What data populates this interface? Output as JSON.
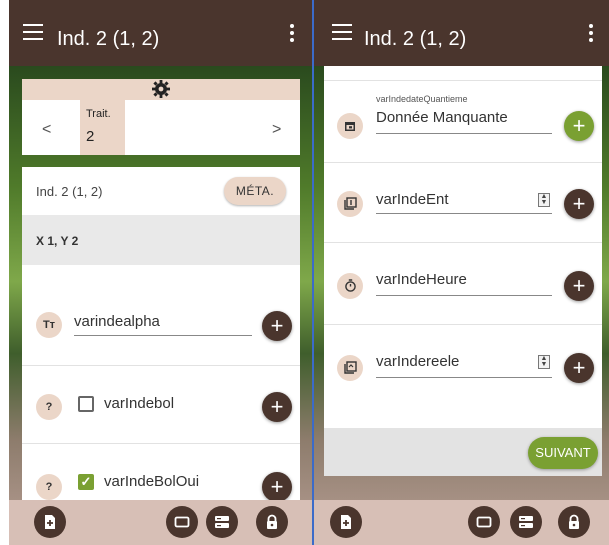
{
  "left": {
    "title": "Ind. 2 (1, 2)",
    "tab": {
      "label": "Trait.",
      "value": "2"
    },
    "card_header": "Ind. 2 (1, 2)",
    "meta_button": "MÉTA.",
    "coords": "X 1, Y 2",
    "fields": [
      {
        "icon": "Tт",
        "value": "varindealpha"
      },
      {
        "label": "varIndebol",
        "checked": false
      },
      {
        "label": "varIndeBolOui",
        "checked": true
      }
    ]
  },
  "right": {
    "title": "Ind. 2 (1, 2)",
    "fields": [
      {
        "small_label": "varIndedateQuantieme",
        "value": "Donnée Manquante"
      },
      {
        "value": "varIndeEnt"
      },
      {
        "value": "varIndeHeure"
      },
      {
        "value": "varIndereele"
      }
    ],
    "next_button": "SUIVANT"
  },
  "colors": {
    "appbar": "#4a352d",
    "accent": "#7aa032",
    "peach": "#ebd6c8",
    "divider": "#3b6bc9"
  },
  "icons": [
    "menu-icon",
    "kebab-menu-icon",
    "gear-icon",
    "chevron-left-icon",
    "chevron-right-icon",
    "text-type-icon",
    "help-icon",
    "calendar-icon",
    "number-icon",
    "timer-icon",
    "decimal-icon",
    "plus-icon",
    "add-document-icon",
    "rectangle-icon",
    "list-icon",
    "lock-icon",
    "check-icon",
    "spinner-icon"
  ]
}
